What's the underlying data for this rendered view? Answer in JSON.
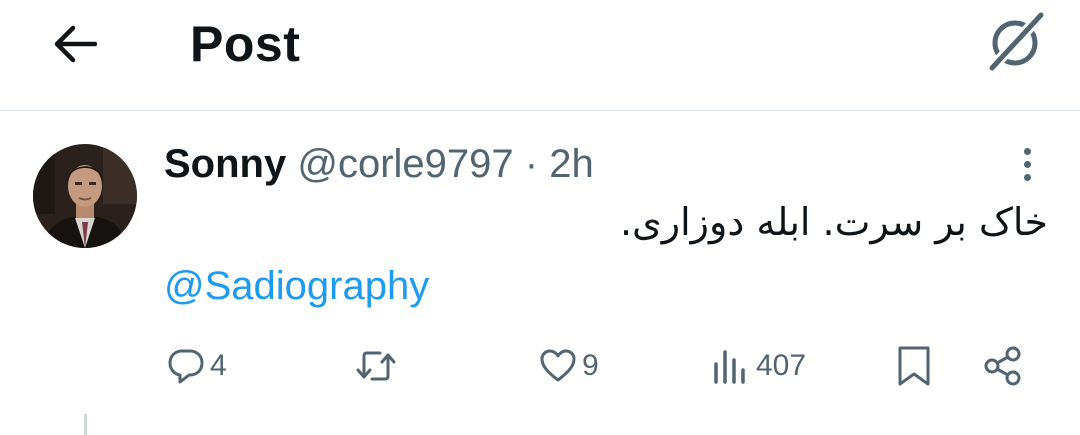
{
  "header": {
    "title": "Post",
    "back_icon": "arrow-left-icon",
    "grok_icon": "grok-icon"
  },
  "tweet": {
    "author_name": "Sonny",
    "handle": "@corle9797",
    "separator": "·",
    "time": "2h",
    "text": "خاک بر سرت. ابله دوزاری.",
    "mention": "@Sadiography",
    "more_icon": "more-vertical-icon"
  },
  "actions": {
    "replies": "4",
    "retweets": "",
    "likes": "9",
    "views": "407",
    "icons": [
      "reply-icon",
      "retweet-icon",
      "like-icon",
      "views-icon",
      "bookmark-icon",
      "share-icon"
    ]
  },
  "colors": {
    "text": "#0f1419",
    "secondary": "#536471",
    "link": "#1d9bf0",
    "divider": "#e1e6ea"
  }
}
